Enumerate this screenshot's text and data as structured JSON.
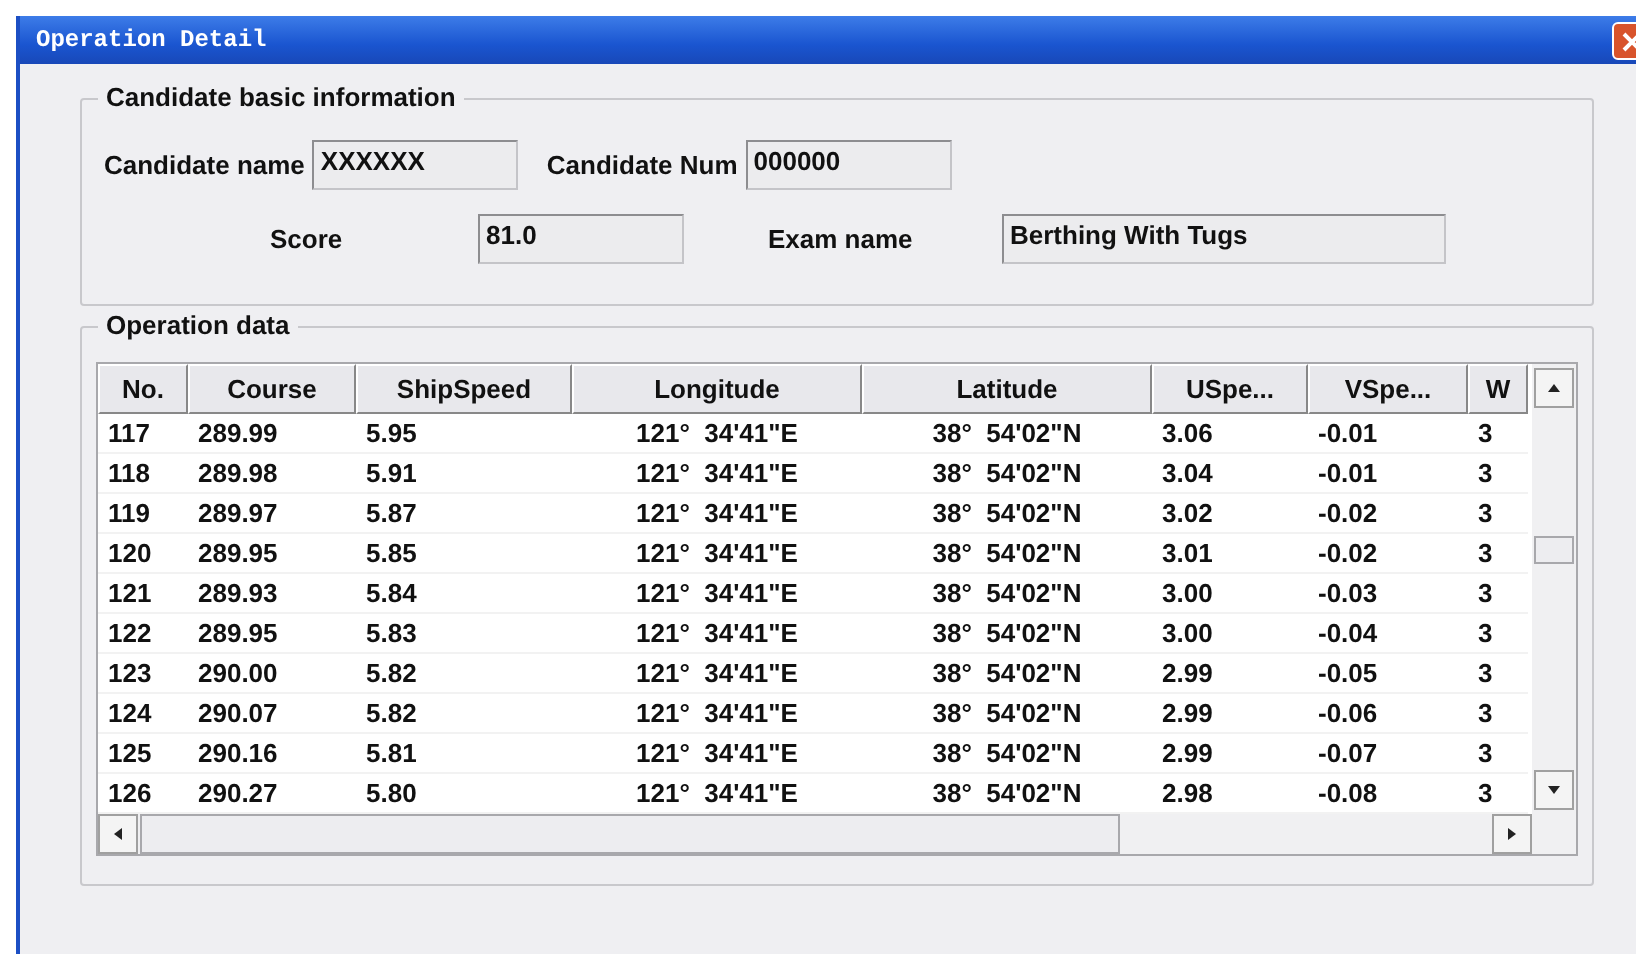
{
  "window": {
    "title": "Operation Detail"
  },
  "candidate_info": {
    "title": "Candidate basic information",
    "fields": [
      {
        "label": "Candidate name",
        "value": "XXXXXX"
      },
      {
        "label": "Candidate Num",
        "value": "000000"
      },
      {
        "label": "Score",
        "value": "81.0"
      },
      {
        "label": "Exam name",
        "value": "Berthing With Tugs"
      }
    ]
  },
  "operation_data": {
    "title": "Operation data",
    "columns": [
      "No.",
      "Course",
      "ShipSpeed",
      "Longitude",
      "Latitude",
      "USpe...",
      "VSpe...",
      "W"
    ],
    "rows": [
      [
        "117",
        "289.99",
        "5.95",
        "121°  34'41\"E",
        "38°  54'02\"N",
        "3.06",
        "-0.01",
        "3"
      ],
      [
        "118",
        "289.98",
        "5.91",
        "121°  34'41\"E",
        "38°  54'02\"N",
        "3.04",
        "-0.01",
        "3"
      ],
      [
        "119",
        "289.97",
        "5.87",
        "121°  34'41\"E",
        "38°  54'02\"N",
        "3.02",
        "-0.02",
        "3"
      ],
      [
        "120",
        "289.95",
        "5.85",
        "121°  34'41\"E",
        "38°  54'02\"N",
        "3.01",
        "-0.02",
        "3"
      ],
      [
        "121",
        "289.93",
        "5.84",
        "121°  34'41\"E",
        "38°  54'02\"N",
        "3.00",
        "-0.03",
        "3"
      ],
      [
        "122",
        "289.95",
        "5.83",
        "121°  34'41\"E",
        "38°  54'02\"N",
        "3.00",
        "-0.04",
        "3"
      ],
      [
        "123",
        "290.00",
        "5.82",
        "121°  34'41\"E",
        "38°  54'02\"N",
        "2.99",
        "-0.05",
        "3"
      ],
      [
        "124",
        "290.07",
        "5.82",
        "121°  34'41\"E",
        "38°  54'02\"N",
        "2.99",
        "-0.06",
        "3"
      ],
      [
        "125",
        "290.16",
        "5.81",
        "121°  34'41\"E",
        "38°  54'02\"N",
        "2.99",
        "-0.07",
        "3"
      ],
      [
        "126",
        "290.27",
        "5.80",
        "121°  34'41\"E",
        "38°  54'02\"N",
        "2.98",
        "-0.08",
        "3"
      ]
    ]
  }
}
